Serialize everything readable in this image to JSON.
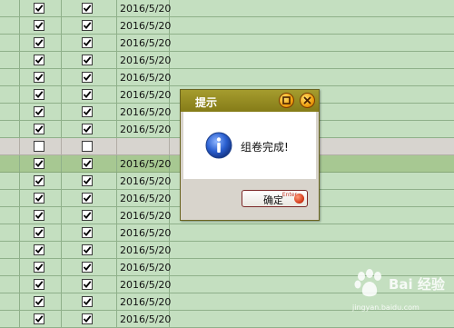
{
  "grid": {
    "rows": [
      {
        "checked1": true,
        "checked2": true,
        "date": "2016/5/20"
      },
      {
        "checked1": true,
        "checked2": true,
        "date": "2016/5/20"
      },
      {
        "checked1": true,
        "checked2": true,
        "date": "2016/5/20"
      },
      {
        "checked1": true,
        "checked2": true,
        "date": "2016/5/20"
      },
      {
        "checked1": true,
        "checked2": true,
        "date": "2016/5/20"
      },
      {
        "checked1": true,
        "checked2": true,
        "date": "2016/5/20"
      },
      {
        "checked1": true,
        "checked2": true,
        "date": "2016/5/20"
      },
      {
        "checked1": true,
        "checked2": true,
        "date": "2016/5/20"
      },
      {
        "checked1": false,
        "checked2": false,
        "date": "",
        "empty": true
      },
      {
        "checked1": true,
        "checked2": true,
        "date": "2016/5/20",
        "selected": true
      },
      {
        "checked1": true,
        "checked2": true,
        "date": "2016/5/20"
      },
      {
        "checked1": true,
        "checked2": true,
        "date": "2016/5/20"
      },
      {
        "checked1": true,
        "checked2": true,
        "date": "2016/5/20"
      },
      {
        "checked1": true,
        "checked2": true,
        "date": "2016/5/20"
      },
      {
        "checked1": true,
        "checked2": true,
        "date": "2016/5/20"
      },
      {
        "checked1": true,
        "checked2": true,
        "date": "2016/5/20"
      },
      {
        "checked1": true,
        "checked2": true,
        "date": "2016/5/20"
      },
      {
        "checked1": true,
        "checked2": true,
        "date": "2016/5/20"
      },
      {
        "checked1": true,
        "checked2": true,
        "date": "2016/5/20"
      }
    ]
  },
  "dialog": {
    "title": "提示",
    "message": "组卷完成!",
    "ok_label": "确定",
    "ok_hint": "Enter",
    "icon": "info-icon"
  },
  "watermark": {
    "text": "Bai 经验",
    "url": "jingyan.baidu.com"
  },
  "colors": {
    "grid_bg": "#c4dfc0",
    "grid_line": "#8fb08a",
    "selected_row": "#a7c892",
    "empty_row": "#d7d4cf",
    "titlebar": "#948b22",
    "button_accent": "#d43a1a"
  }
}
